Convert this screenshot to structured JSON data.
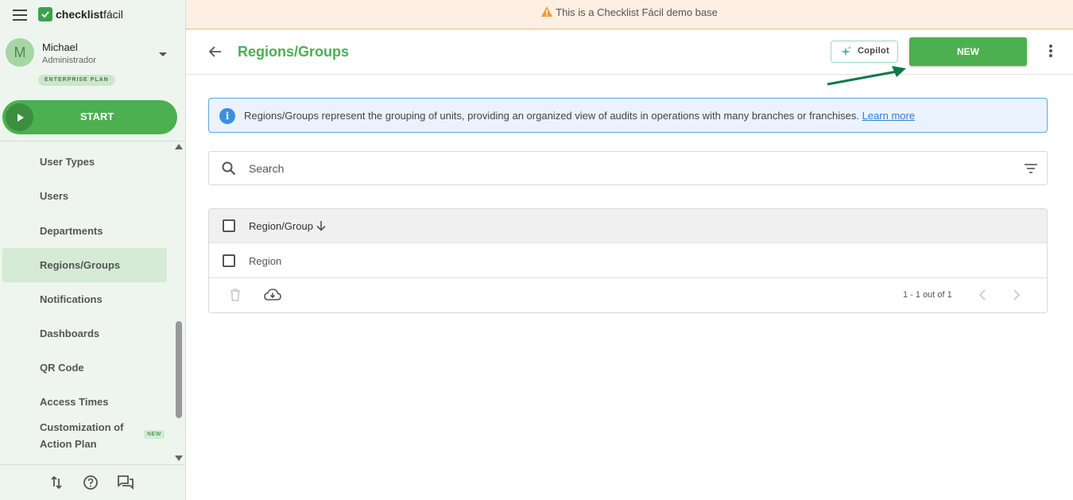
{
  "app": {
    "logo_bold": "checklist",
    "logo_light": "fácil"
  },
  "user": {
    "initial": "M",
    "name": "Michael",
    "role": "Administrador",
    "plan": "ENTERPRISE PLAN"
  },
  "start_label": "START",
  "menu": {
    "items": [
      {
        "label": "User Types"
      },
      {
        "label": "Users"
      },
      {
        "label": "Departments"
      },
      {
        "label": "Regions/Groups",
        "active": true
      },
      {
        "label": "Notifications"
      },
      {
        "label": "Dashboards"
      },
      {
        "label": "QR Code"
      },
      {
        "label": "Access Times"
      },
      {
        "label": "Customization of Action Plan",
        "badge": "NEW"
      }
    ]
  },
  "banner": {
    "text": "This is a Checklist Fácil demo base"
  },
  "header": {
    "title": "Regions/Groups",
    "copilot_label": "Copilot",
    "new_label": "NEW"
  },
  "info": {
    "text": "Regions/Groups represent the grouping of units, providing an organized view of audits in operations with many branches or franchises.",
    "link": "Learn more"
  },
  "search": {
    "placeholder": "Search",
    "value": ""
  },
  "table": {
    "column_header": "Region/Group",
    "rows": [
      {
        "label": "Region"
      }
    ],
    "pagination": "1 - 1 out of 1"
  },
  "colors": {
    "brand_green": "#4caf50",
    "info_blue": "#3d8fe0",
    "warning_orange": "#f39a3a",
    "annotation_arrow": "#0a7a4a"
  }
}
